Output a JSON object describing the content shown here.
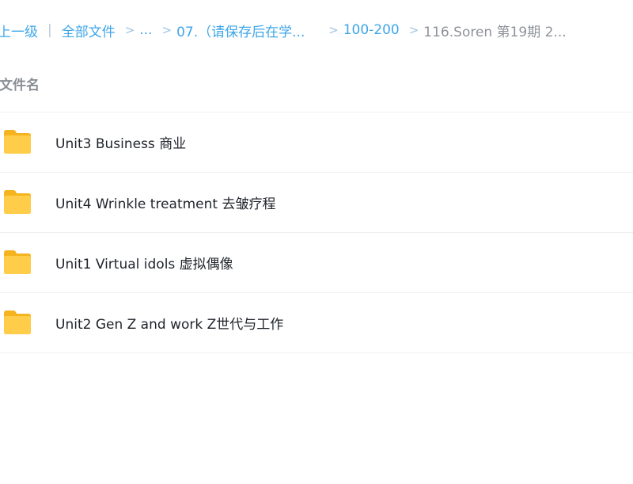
{
  "breadcrumb": {
    "up_label": "上一级",
    "pipe": "|",
    "all_files": "全部文件",
    "chevron": ">",
    "ellipsis": "...",
    "folder_1": "07.（请保存后在学...",
    "folder_2": "100-200",
    "current": "116.Soren 第19期 2..."
  },
  "list": {
    "column_name": "文件名",
    "items": [
      {
        "name": "Unit3 Business 商业",
        "icon": "folder-icon"
      },
      {
        "name": "Unit4 Wrinkle treatment 去皱疗程",
        "icon": "folder-icon"
      },
      {
        "name": "Unit1 Virtual idols 虚拟偶像",
        "icon": "folder-icon"
      },
      {
        "name": "Unit2 Gen Z and work Z世代与工作",
        "icon": "folder-icon"
      }
    ]
  },
  "colors": {
    "link": "#3ea6e8",
    "current": "#8e9299",
    "folder_yellow": "#ffc53d"
  }
}
